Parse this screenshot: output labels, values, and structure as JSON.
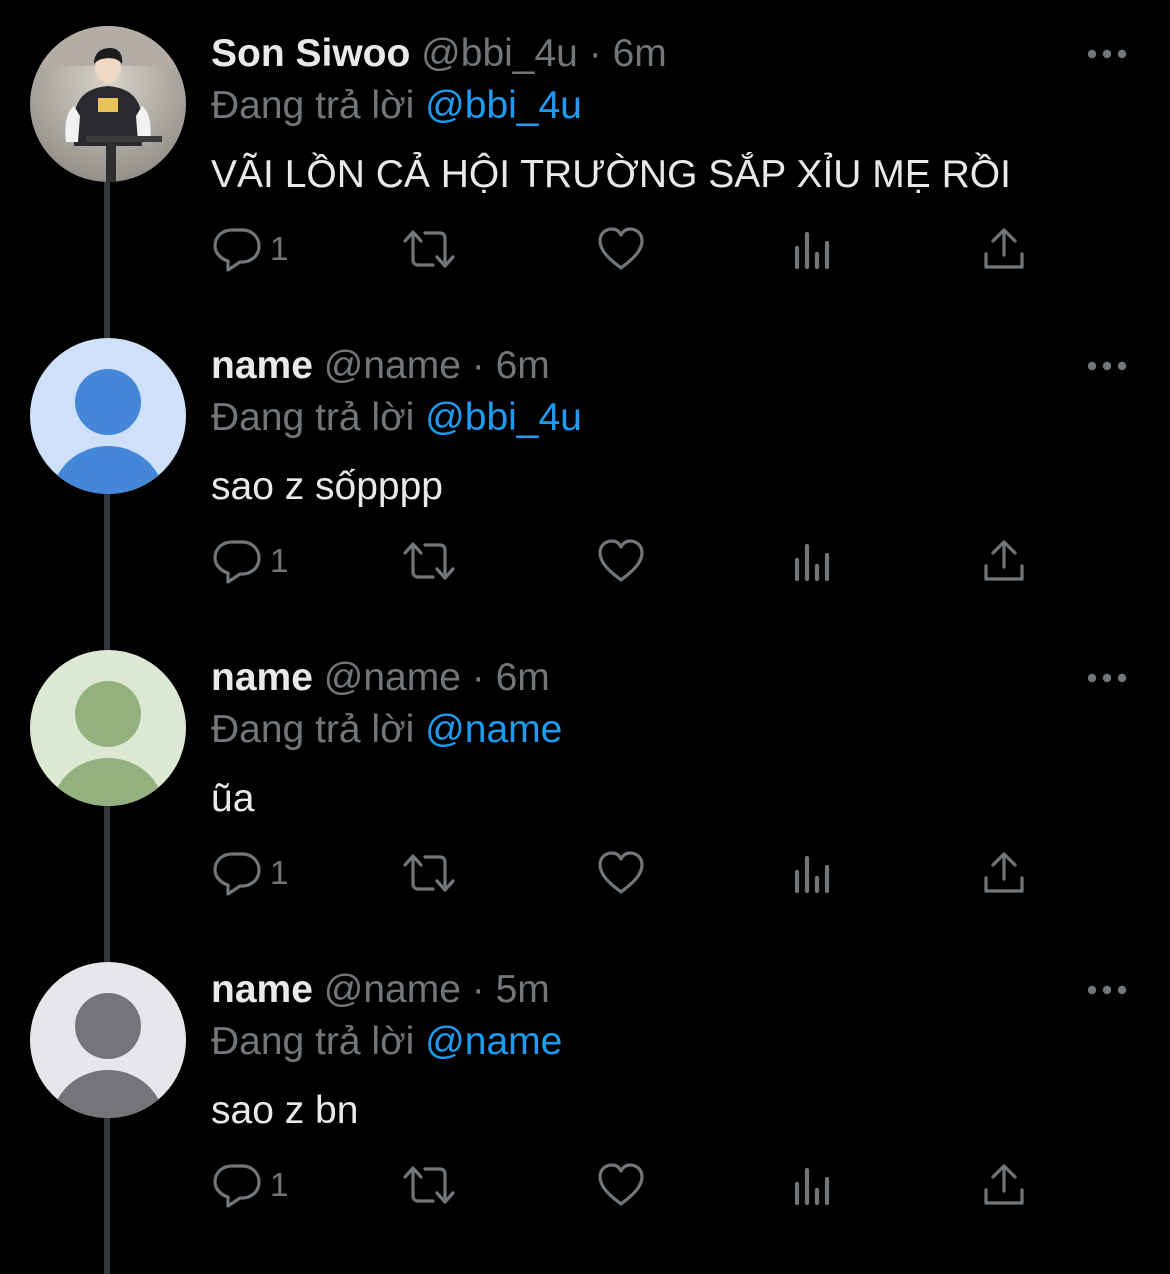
{
  "colors": {
    "background": "#000000",
    "primary_text": "#e7e9ea",
    "secondary_text": "#71767b",
    "link": "#1d9bf0",
    "thread_line": "#333639"
  },
  "icons": {
    "more": "more-dots-icon",
    "reply": "reply-bubble-icon",
    "retweet": "retweet-arrows-icon",
    "like": "heart-icon",
    "views": "views-bar-chart-icon",
    "share": "share-upload-icon"
  },
  "tweets": [
    {
      "display_name": "Son Siwoo",
      "handle": "@bbi_4u",
      "separator": "·",
      "time": "6m",
      "reply_prefix": "Đang trả lời",
      "reply_to": "@bbi_4u",
      "text": "VÃI LỒN CẢ HỘI TRƯỜNG SẮP XỈU MẸ RỒI",
      "reply_count": "1",
      "avatar_type": "photo"
    },
    {
      "display_name": "name",
      "handle": "@name",
      "separator": "·",
      "time": "6m",
      "reply_prefix": "Đang trả lời",
      "reply_to": "@bbi_4u",
      "text": "sao z sốpppp",
      "reply_count": "1",
      "avatar_type": "default",
      "avatar_bg": "#cfe0fb",
      "avatar_fg": "#4487d9"
    },
    {
      "display_name": "name",
      "handle": "@name",
      "separator": "·",
      "time": "6m",
      "reply_prefix": "Đang trả lời",
      "reply_to": "@name",
      "text": "ũa",
      "reply_count": "1",
      "avatar_type": "default",
      "avatar_bg": "#dde8d2",
      "avatar_fg": "#93b07f"
    },
    {
      "display_name": "name",
      "handle": "@name",
      "separator": "·",
      "time": "5m",
      "reply_prefix": "Đang trả lời",
      "reply_to": "@name",
      "text": "sao z bn",
      "reply_count": "1",
      "avatar_type": "default",
      "avatar_bg": "#e6e7ea",
      "avatar_fg": "#737579"
    }
  ]
}
